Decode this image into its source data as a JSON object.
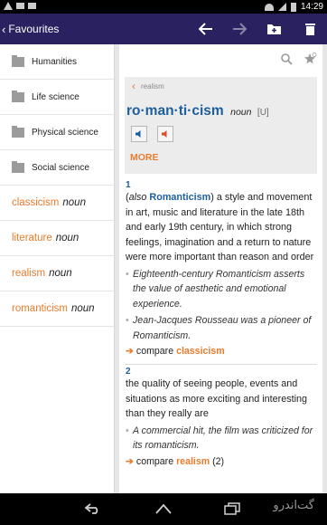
{
  "status_bar": {
    "time": "14:29"
  },
  "header": {
    "title": "Favourites",
    "icons": [
      "back-arrow-icon",
      "forward-arrow-icon",
      "add-icon",
      "delete-icon"
    ]
  },
  "sidebar": {
    "folders": [
      {
        "label": "Humanities"
      },
      {
        "label": "Life science"
      },
      {
        "label": "Physical science"
      },
      {
        "label": "Social science"
      }
    ],
    "favourites": [
      {
        "word": "classicism",
        "pos": "noun"
      },
      {
        "word": "literature",
        "pos": "noun"
      },
      {
        "word": "realism",
        "pos": "noun"
      },
      {
        "word": "romanticism",
        "pos": "noun"
      }
    ]
  },
  "entry": {
    "breadcrumb": "realism",
    "headword": "ro·man·ti·cism",
    "pos": "noun",
    "grammar": "[U]",
    "more_label": "MORE",
    "senses": [
      {
        "number": "1",
        "also_prefix": "(",
        "also_label": "also",
        "also_word": "Romanticism",
        "definition": ") a style and movement in art, music and literature in the late 18th and early 19th century, in which strong feelings, imagination and a return to nature were more important than reason and order",
        "examples": [
          "Eighteenth-century Romanticism asserts the value of aesthetic and emotional experience.",
          "Jean-Jacques Rousseau was a pioneer of Romanticism."
        ],
        "compare_label": "compare",
        "compare_word": "classicism",
        "compare_suffix": ""
      },
      {
        "number": "2",
        "definition": "the quality of seeing people, events and situations as more exciting and interesting than they really are",
        "examples": [
          "A commercial hit, the film was criticized for its romanticism."
        ],
        "compare_label": "compare",
        "compare_word": "realism",
        "compare_suffix": "(2)"
      }
    ]
  },
  "watermark": "گت‌اندرو",
  "colors": {
    "app_bar": "#2a2160",
    "accent": "#e87c2e",
    "link": "#1c5f9e"
  }
}
